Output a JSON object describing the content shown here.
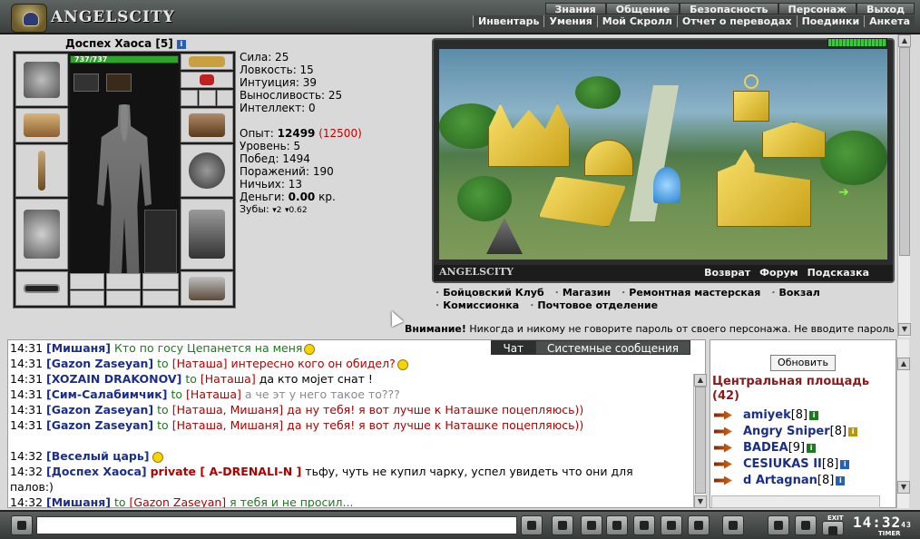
{
  "header": {
    "logo_text": "ANGELSCITY",
    "nav_top": [
      "Знания",
      "Общение",
      "Безопасность",
      "Персонаж",
      "Выход"
    ],
    "nav_bottom": [
      "Инвентарь",
      "Умения",
      "Мой Скролл",
      "Отчет о переводах",
      "Поединки",
      "Анкета"
    ]
  },
  "character": {
    "name": "Доспех Хаоса",
    "level": "[5]",
    "hp": "737/737",
    "hp_fraction": 1.0,
    "stats": {
      "sila": "Сила: 25",
      "lovkost": "Ловкость: 15",
      "intuicia": "Интуиция: 39",
      "vynoslivost": "Выносливость: 25",
      "intellekt": "Интеллект: 0"
    },
    "exp_label": "Опыт:",
    "exp_value": "12499",
    "exp_next": "(12500)",
    "uroven": "Уровень: 5",
    "pobed": "Побед: 1494",
    "porazheniy": "Поражений: 190",
    "nichih": "Ничьих: 13",
    "dengi_label": "Деньги:",
    "dengi_value": "0.00",
    "dengi_unit": "кр.",
    "zuby_label": "Зубы:",
    "zuby_a": "2",
    "zuby_b": "0.62"
  },
  "map": {
    "title": "ANGELSCITY",
    "links": [
      "Возврат",
      "Форум",
      "Подсказка"
    ]
  },
  "locations": {
    "row1": [
      "Бойцовский Клуб",
      "Магазин",
      "Ремонтная мастерская",
      "Вокзал"
    ],
    "row2": [
      "Комиссионка",
      "Почтовое отделение"
    ]
  },
  "warning": {
    "bold": "Внимание!",
    "text": " Никогда и никому не говорите пароль от своего персонажа. Не вводите пароль на"
  },
  "chat": {
    "tabs": [
      "Чат",
      "Системные сообщения"
    ],
    "lines": [
      {
        "time": "14:31",
        "nick": "[Мишаня]",
        "to": "",
        "tgt": "",
        "msg": "Кто по госу Цепанется на меня",
        "msgclass": "msg-g"
      },
      {
        "time": "14:31",
        "nick": "[Gazon Zaseyan]",
        "to": "to",
        "tgt": "[Наташа]",
        "msg": "интересно кого он обидел?",
        "msgclass": "msg-r"
      },
      {
        "time": "14:31",
        "nick": "[XOZAIN DRAKONOV]",
        "to": "to",
        "tgt": "[Наташа]",
        "msg": "да кто моjет снат !",
        "msgclass": "msg-k"
      },
      {
        "time": "14:31",
        "nick": "[Сим-Салабимчик]",
        "to": "to",
        "tgt": "[Наташа]",
        "msg": "а че эт у него такое то???",
        "msgclass": "msg-grey"
      },
      {
        "time": "14:31",
        "nick": "[Gazon Zaseyan]",
        "to": "to",
        "tgt": "[Наташа, Мишаня]",
        "msg": "да ну тебя! я вот лучше к Наташке поцепляюсь))",
        "msgclass": "msg-r"
      },
      {
        "time": "14:31",
        "nick": "[Gazon Zaseyan]",
        "to": "to",
        "tgt": "[Наташа, Мишаня]",
        "msg": "да ну тебя! я вот лучше к Наташке поцепляюсь))",
        "msgclass": "msg-r"
      }
    ],
    "line_vesely": {
      "time": "14:32",
      "nick": "[Веселый царь]"
    },
    "line_private": {
      "time": "14:32",
      "nick": "[Доспех Хаоса]",
      "priv": "private [ A-DRENALI-N ]",
      "msg": "тьфу, чуть не купил чарку, успел увидеть что они для",
      "msg2": "палов:)"
    },
    "line_last": {
      "time": "14:32",
      "nick": "[Мишаня]",
      "to": "to",
      "tgt": "[Gazon Zaseyan]",
      "msg": "я тебя и не просил..."
    }
  },
  "users": {
    "refresh_label": "Обновить",
    "location_name": "Центральная площадь",
    "location_count": "(42)",
    "list": [
      {
        "name": "amiyek",
        "level": "[8]",
        "badge": "green"
      },
      {
        "name": "Angry Sniper",
        "level": "[8]",
        "badge": "yellow"
      },
      {
        "name": "BADEA",
        "level": "[9]",
        "badge": "green"
      },
      {
        "name": "CESIUKAS II",
        "level": "[8]",
        "badge": "blue"
      },
      {
        "name": "d Artagnan",
        "level": "[8]",
        "badge": "blue"
      }
    ]
  },
  "toolbar": {
    "clock": "14:32",
    "clock_sec": "43",
    "timer_label": "TIMER",
    "exit_label": "EXIT"
  }
}
